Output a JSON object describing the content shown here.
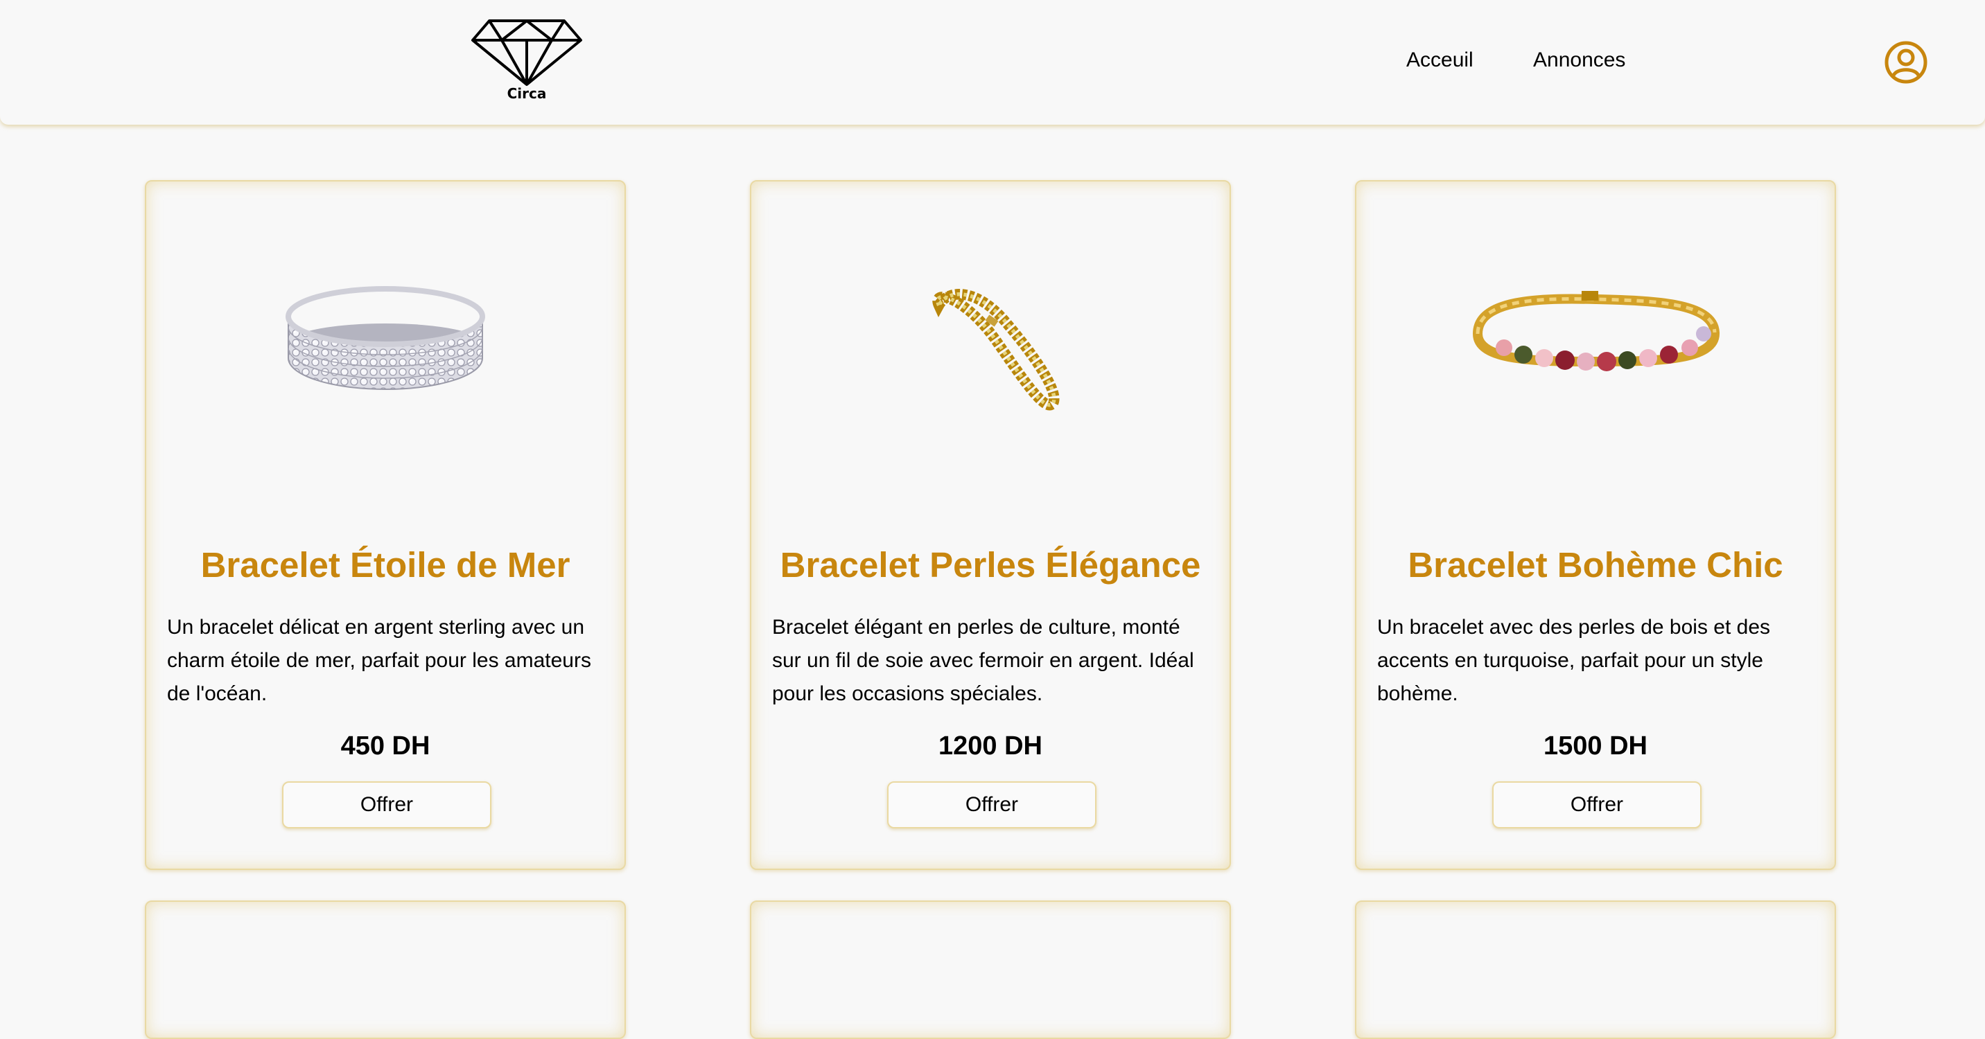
{
  "header": {
    "logo_text": "Circa",
    "nav": {
      "accueil": "Acceuil",
      "annonces": "Annonces"
    }
  },
  "colors": {
    "accent": "#c8860e",
    "border": "#e9d9a3",
    "background": "#f8f8f8"
  },
  "products": [
    {
      "title": "Bracelet Étoile de Mer",
      "description": "Un bracelet délicat en argent sterling avec un charm étoile de mer, parfait pour les amateurs de l'océan.",
      "price": "450 DH",
      "button": "Offrer",
      "image_icon": "silver-rhinestone-bracelet"
    },
    {
      "title": "Bracelet Perles Élégance",
      "description": "Bracelet élégant en perles de culture, monté sur un fil de soie avec fermoir en argent. Idéal pour les occasions spéciales.",
      "price": "1200 DH",
      "button": "Offrer",
      "image_icon": "gold-tennis-bracelet"
    },
    {
      "title": "Bracelet Bohème Chic",
      "description": "Un bracelet avec des perles de bois et des accents en turquoise, parfait pour un style bohème.",
      "price": "1500 DH",
      "button": "Offrer",
      "image_icon": "gold-gemstone-bracelet"
    }
  ]
}
